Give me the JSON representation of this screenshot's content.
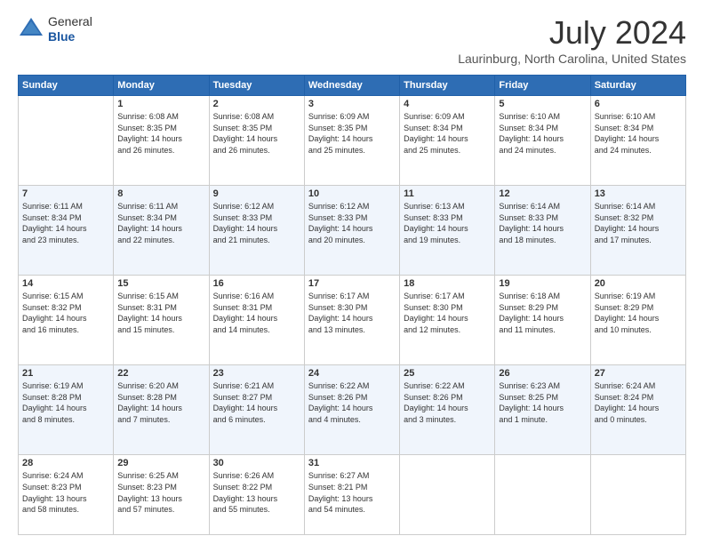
{
  "header": {
    "logo_line1": "General",
    "logo_line2": "Blue",
    "month": "July 2024",
    "location": "Laurinburg, North Carolina, United States"
  },
  "weekdays": [
    "Sunday",
    "Monday",
    "Tuesday",
    "Wednesday",
    "Thursday",
    "Friday",
    "Saturday"
  ],
  "weeks": [
    [
      {
        "day": "",
        "content": ""
      },
      {
        "day": "1",
        "content": "Sunrise: 6:08 AM\nSunset: 8:35 PM\nDaylight: 14 hours\nand 26 minutes."
      },
      {
        "day": "2",
        "content": "Sunrise: 6:08 AM\nSunset: 8:35 PM\nDaylight: 14 hours\nand 26 minutes."
      },
      {
        "day": "3",
        "content": "Sunrise: 6:09 AM\nSunset: 8:35 PM\nDaylight: 14 hours\nand 25 minutes."
      },
      {
        "day": "4",
        "content": "Sunrise: 6:09 AM\nSunset: 8:34 PM\nDaylight: 14 hours\nand 25 minutes."
      },
      {
        "day": "5",
        "content": "Sunrise: 6:10 AM\nSunset: 8:34 PM\nDaylight: 14 hours\nand 24 minutes."
      },
      {
        "day": "6",
        "content": "Sunrise: 6:10 AM\nSunset: 8:34 PM\nDaylight: 14 hours\nand 24 minutes."
      }
    ],
    [
      {
        "day": "7",
        "content": "Sunrise: 6:11 AM\nSunset: 8:34 PM\nDaylight: 14 hours\nand 23 minutes."
      },
      {
        "day": "8",
        "content": "Sunrise: 6:11 AM\nSunset: 8:34 PM\nDaylight: 14 hours\nand 22 minutes."
      },
      {
        "day": "9",
        "content": "Sunrise: 6:12 AM\nSunset: 8:33 PM\nDaylight: 14 hours\nand 21 minutes."
      },
      {
        "day": "10",
        "content": "Sunrise: 6:12 AM\nSunset: 8:33 PM\nDaylight: 14 hours\nand 20 minutes."
      },
      {
        "day": "11",
        "content": "Sunrise: 6:13 AM\nSunset: 8:33 PM\nDaylight: 14 hours\nand 19 minutes."
      },
      {
        "day": "12",
        "content": "Sunrise: 6:14 AM\nSunset: 8:33 PM\nDaylight: 14 hours\nand 18 minutes."
      },
      {
        "day": "13",
        "content": "Sunrise: 6:14 AM\nSunset: 8:32 PM\nDaylight: 14 hours\nand 17 minutes."
      }
    ],
    [
      {
        "day": "14",
        "content": "Sunrise: 6:15 AM\nSunset: 8:32 PM\nDaylight: 14 hours\nand 16 minutes."
      },
      {
        "day": "15",
        "content": "Sunrise: 6:15 AM\nSunset: 8:31 PM\nDaylight: 14 hours\nand 15 minutes."
      },
      {
        "day": "16",
        "content": "Sunrise: 6:16 AM\nSunset: 8:31 PM\nDaylight: 14 hours\nand 14 minutes."
      },
      {
        "day": "17",
        "content": "Sunrise: 6:17 AM\nSunset: 8:30 PM\nDaylight: 14 hours\nand 13 minutes."
      },
      {
        "day": "18",
        "content": "Sunrise: 6:17 AM\nSunset: 8:30 PM\nDaylight: 14 hours\nand 12 minutes."
      },
      {
        "day": "19",
        "content": "Sunrise: 6:18 AM\nSunset: 8:29 PM\nDaylight: 14 hours\nand 11 minutes."
      },
      {
        "day": "20",
        "content": "Sunrise: 6:19 AM\nSunset: 8:29 PM\nDaylight: 14 hours\nand 10 minutes."
      }
    ],
    [
      {
        "day": "21",
        "content": "Sunrise: 6:19 AM\nSunset: 8:28 PM\nDaylight: 14 hours\nand 8 minutes."
      },
      {
        "day": "22",
        "content": "Sunrise: 6:20 AM\nSunset: 8:28 PM\nDaylight: 14 hours\nand 7 minutes."
      },
      {
        "day": "23",
        "content": "Sunrise: 6:21 AM\nSunset: 8:27 PM\nDaylight: 14 hours\nand 6 minutes."
      },
      {
        "day": "24",
        "content": "Sunrise: 6:22 AM\nSunset: 8:26 PM\nDaylight: 14 hours\nand 4 minutes."
      },
      {
        "day": "25",
        "content": "Sunrise: 6:22 AM\nSunset: 8:26 PM\nDaylight: 14 hours\nand 3 minutes."
      },
      {
        "day": "26",
        "content": "Sunrise: 6:23 AM\nSunset: 8:25 PM\nDaylight: 14 hours\nand 1 minute."
      },
      {
        "day": "27",
        "content": "Sunrise: 6:24 AM\nSunset: 8:24 PM\nDaylight: 14 hours\nand 0 minutes."
      }
    ],
    [
      {
        "day": "28",
        "content": "Sunrise: 6:24 AM\nSunset: 8:23 PM\nDaylight: 13 hours\nand 58 minutes."
      },
      {
        "day": "29",
        "content": "Sunrise: 6:25 AM\nSunset: 8:23 PM\nDaylight: 13 hours\nand 57 minutes."
      },
      {
        "day": "30",
        "content": "Sunrise: 6:26 AM\nSunset: 8:22 PM\nDaylight: 13 hours\nand 55 minutes."
      },
      {
        "day": "31",
        "content": "Sunrise: 6:27 AM\nSunset: 8:21 PM\nDaylight: 13 hours\nand 54 minutes."
      },
      {
        "day": "",
        "content": ""
      },
      {
        "day": "",
        "content": ""
      },
      {
        "day": "",
        "content": ""
      }
    ]
  ]
}
